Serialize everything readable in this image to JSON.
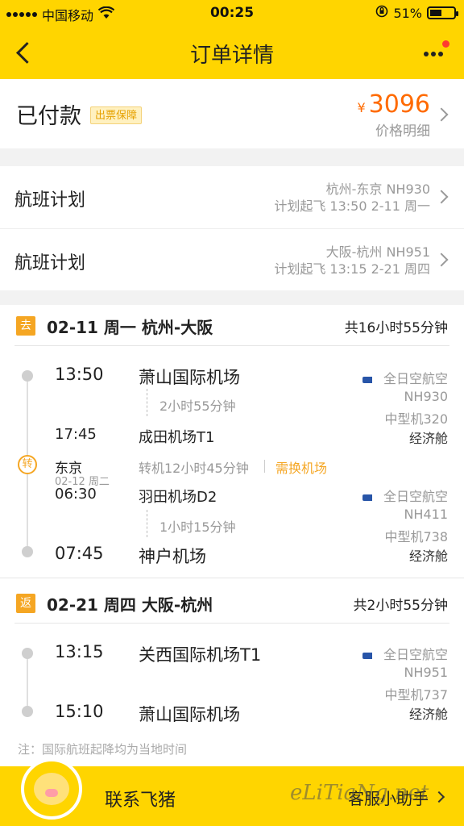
{
  "status_bar": {
    "carrier": "中国移动",
    "time": "00:25",
    "battery": "51%",
    "battery_level": 0.51
  },
  "header": {
    "title": "订单详情"
  },
  "payment": {
    "status": "已付款",
    "badge": "出票保障",
    "currency": "¥",
    "amount": "3096",
    "detail_label": "价格明细"
  },
  "flight_plans": [
    {
      "label": "航班计划",
      "route": "杭州-东京 NH930",
      "time": "计划起飞 13:50 2-11 周一"
    },
    {
      "label": "航班计划",
      "route": "大阪-杭州 NH951",
      "time": "计划起飞 13:15 2-21 周四"
    }
  ],
  "outbound": {
    "tag": "去",
    "title": "02-11 周一 杭州-大阪",
    "duration": "共16小时55分钟",
    "seg1": {
      "dep_time": "13:50",
      "dep_airport": "萧山国际机场",
      "flight_time": "2小时55分钟",
      "arr_time": "17:45",
      "arr_airport": "成田机场T1",
      "airline": "全日空航空",
      "flight_no": "NH930",
      "aircraft": "中型机320",
      "cabin": "经济舱"
    },
    "transfer": {
      "icon_label": "转",
      "city": "东京",
      "date": "02-12 周二",
      "wait": "转机12小时45分钟",
      "notice": "需换机场"
    },
    "seg2": {
      "dep_time": "06:30",
      "dep_airport": "羽田机场D2",
      "flight_time": "1小时15分钟",
      "arr_time": "07:45",
      "arr_airport": "神户机场",
      "airline": "全日空航空",
      "flight_no": "NH411",
      "aircraft": "中型机738",
      "cabin": "经济舱"
    }
  },
  "return": {
    "tag": "返",
    "title": "02-21 周四 大阪-杭州",
    "duration": "共2小时55分钟",
    "dep_time": "13:15",
    "dep_airport": "关西国际机场T1",
    "arr_time": "15:10",
    "arr_airport": "萧山国际机场",
    "airline": "全日空航空",
    "flight_no": "NH951",
    "aircraft": "中型机737",
    "cabin": "经济舱"
  },
  "note": "注：国际航班起降均为当地时间",
  "bottom_bar": {
    "contact": "联系飞猪",
    "helper": "客服小助手"
  },
  "watermark": "eLiTiaNg.net"
}
